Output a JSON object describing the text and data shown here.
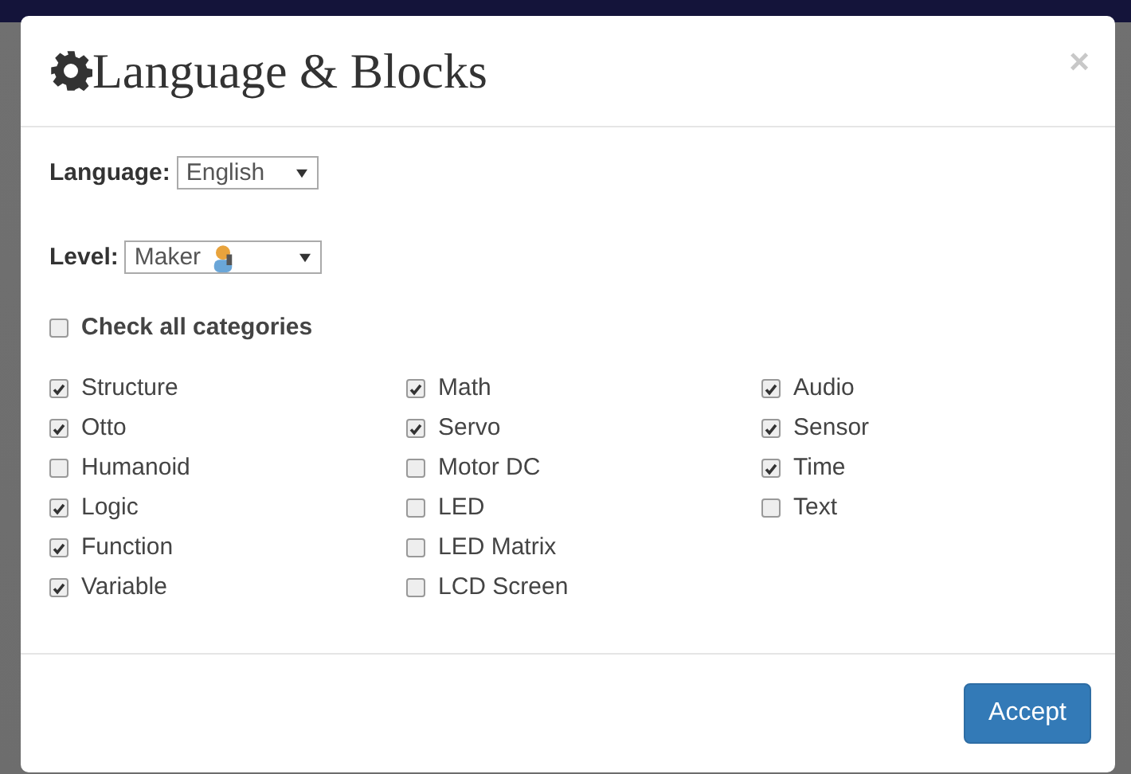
{
  "dialog": {
    "title": "Language & Blocks",
    "close": "×"
  },
  "language": {
    "label": "Language:",
    "value": "English"
  },
  "level": {
    "label": "Level:",
    "value": "Maker"
  },
  "check_all": {
    "label": "Check all categories",
    "checked": false
  },
  "categories": [
    [
      {
        "label": "Structure",
        "checked": true
      },
      {
        "label": "Otto",
        "checked": true
      },
      {
        "label": "Humanoid",
        "checked": false
      },
      {
        "label": "Logic",
        "checked": true
      },
      {
        "label": "Function",
        "checked": true
      },
      {
        "label": "Variable",
        "checked": true
      }
    ],
    [
      {
        "label": "Math",
        "checked": true
      },
      {
        "label": "Servo",
        "checked": true
      },
      {
        "label": "Motor DC",
        "checked": false
      },
      {
        "label": "LED",
        "checked": false
      },
      {
        "label": "LED Matrix",
        "checked": false
      },
      {
        "label": "LCD Screen",
        "checked": false
      }
    ],
    [
      {
        "label": "Audio",
        "checked": true
      },
      {
        "label": "Sensor",
        "checked": true
      },
      {
        "label": "Time",
        "checked": true
      },
      {
        "label": "Text",
        "checked": false
      }
    ]
  ],
  "buttons": [
    {
      "label": "Accept"
    }
  ]
}
